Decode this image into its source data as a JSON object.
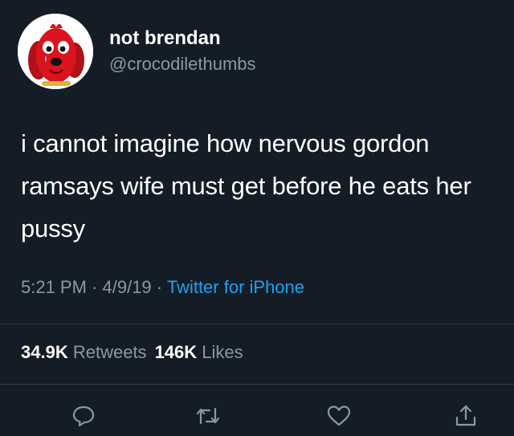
{
  "user": {
    "display_name": "not brendan",
    "handle": "@crocodilethumbs",
    "avatar_icon": "red-dog-avatar"
  },
  "tweet": {
    "text": "i cannot imagine how nervous gordon ramsays wife must get before he eats her pussy"
  },
  "meta": {
    "time": "5:21 PM",
    "sep1": " · ",
    "date": "4/9/19",
    "sep2": " · ",
    "source": "Twitter for iPhone"
  },
  "stats": {
    "retweets_count": "34.9K",
    "retweets_label": "Retweets",
    "likes_count": "146K",
    "likes_label": "Likes"
  },
  "actions": [
    {
      "icon": "reply-icon"
    },
    {
      "icon": "retweet-icon"
    },
    {
      "icon": "like-icon"
    },
    {
      "icon": "share-icon"
    }
  ],
  "colors": {
    "background": "#141d26",
    "text": "#ffffff",
    "secondary": "#8899a6",
    "link": "#1da1f2",
    "divider": "#2b3945"
  }
}
